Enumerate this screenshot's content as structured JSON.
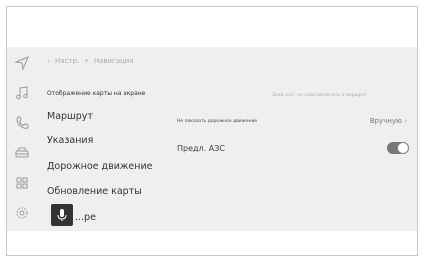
{
  "breadcrumb": {
    "back": "‹",
    "settings": "Настр.",
    "sep": "•",
    "current": "Навигация"
  },
  "menu": [
    {
      "label": "Отображение карты на экране"
    },
    {
      "label": "Маршрут"
    },
    {
      "label": "Указания"
    },
    {
      "label": "Дорожное движение"
    },
    {
      "label": "Обновление карты"
    },
    {
      "label": "...ре"
    }
  ],
  "panel": {
    "hint": "Зона, кот. не надо включать в маршрут",
    "avoid_label": "Не показать дорожное движение",
    "avoid_value": "Вручную",
    "fuel_label": "Предл. АЗС",
    "fuel_toggle_on": true
  },
  "rail_icons": [
    "navigation-icon",
    "music-icon",
    "phone-icon",
    "car-icon",
    "apps-icon",
    "settings-icon"
  ]
}
